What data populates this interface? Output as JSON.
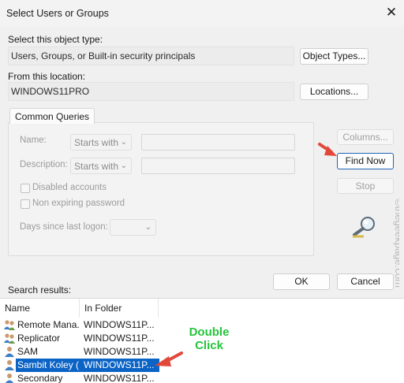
{
  "window": {
    "title": "Select Users or Groups",
    "close_glyph": "✕"
  },
  "object_type": {
    "label": "Select this object type:",
    "value": "Users, Groups, or Built-in security principals",
    "button": "Object Types..."
  },
  "location": {
    "label": "From this location:",
    "value": "WINDOWS11PRO",
    "button": "Locations..."
  },
  "common_queries": {
    "tab": "Common Queries",
    "name_label": "Name:",
    "name_mode": "Starts with",
    "description_label": "Description:",
    "description_mode": "Starts with",
    "disabled_accounts": "Disabled accounts",
    "non_expiring_password": "Non expiring password",
    "days_since_logon_label": "Days since last logon:"
  },
  "side_buttons": {
    "columns": "Columns...",
    "find_now": "Find Now",
    "stop": "Stop"
  },
  "search_results_label": "Search results:",
  "buttons": {
    "ok": "OK",
    "cancel": "Cancel"
  },
  "results": {
    "columns": [
      "Name",
      "In Folder"
    ],
    "rows": [
      {
        "name": "Remote Mana...",
        "folder": "WINDOWS11P...",
        "icon": "group-icon"
      },
      {
        "name": "Replicator",
        "folder": "WINDOWS11P...",
        "icon": "group-icon"
      },
      {
        "name": "SAM",
        "folder": "WINDOWS11P...",
        "icon": "user-icon"
      },
      {
        "name": "Sambit Koley (...",
        "folder": "WINDOWS11P...",
        "icon": "user-icon",
        "selected": true
      },
      {
        "name": "Secondary",
        "folder": "WINDOWS11P...",
        "icon": "user-icon"
      }
    ]
  },
  "annotations": {
    "double_click_line1": "Double",
    "double_click_line2": "Click",
    "arrow_color": "#e2483a"
  },
  "watermark": "©thegeekpage.com",
  "colors": {
    "accent": "#1f63b5",
    "selection": "#0b63c5",
    "annotation_text": "#24c43a",
    "annotation_arrow": "#e2483a"
  }
}
